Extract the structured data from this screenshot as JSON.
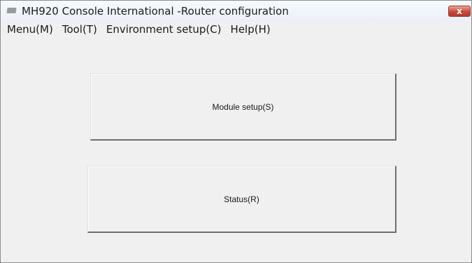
{
  "window": {
    "title": "MH920 Console International -Router configuration",
    "close_label": "x"
  },
  "menubar": {
    "items": [
      "Menu(M)",
      "Tool(T)",
      "Environment setup(C)",
      "Help(H)"
    ]
  },
  "buttons": {
    "module_setup": "Module setup(S)",
    "status": "Status(R)"
  },
  "icons": {
    "app": "app-icon",
    "close": "close-icon"
  }
}
